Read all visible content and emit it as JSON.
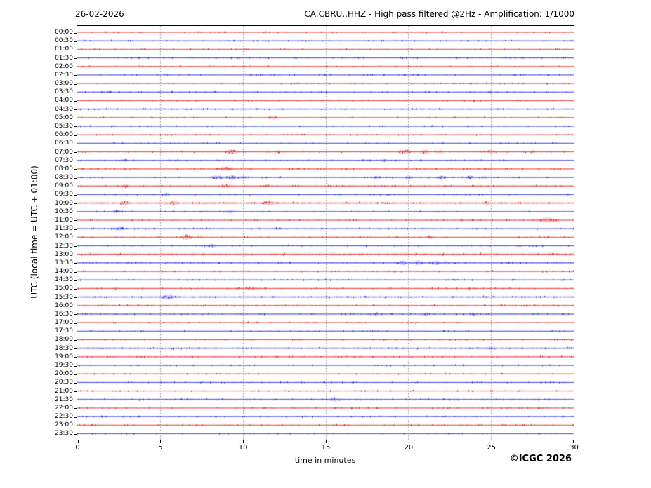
{
  "footer": {
    "copyright": "©ICGC 2026"
  },
  "chart_data": {
    "type": "line",
    "subtype": "helicorder-daily-seismogram",
    "date": "26-02-2026",
    "title": "CA.CBRU..HHZ - High pass filtered @2Hz - Amplification: 1/1000",
    "xlabel": "time in minutes",
    "ylabel": "UTC (local time = UTC + 01:00)",
    "xlim": [
      0,
      30
    ],
    "x_ticks": [
      0,
      5,
      10,
      15,
      20,
      25,
      30
    ],
    "grid": "vertical dashed gray lines every 5 minutes",
    "minutes_per_row": 30,
    "row_color_cycle": [
      "red",
      "blue"
    ],
    "trace_colors": {
      "red": {
        "line": "#ee4545",
        "band": "#f7a6a6",
        "dark": "#cc0808"
      },
      "blue": {
        "line": "#4848ea",
        "band": "#a9a9f6",
        "dark": "#1414c4"
      }
    },
    "frame_color": "#000000",
    "grid_color": "#8a8a8a",
    "rows": [
      {
        "time": "00:00",
        "color": "red",
        "noise_amp": 0.7,
        "events": []
      },
      {
        "time": "00:30",
        "color": "blue",
        "noise_amp": 0.7,
        "events": []
      },
      {
        "time": "01:00",
        "color": "red",
        "noise_amp": 0.7,
        "events": []
      },
      {
        "time": "01:30",
        "color": "blue",
        "noise_amp": 0.9,
        "events": []
      },
      {
        "time": "02:00",
        "color": "red",
        "noise_amp": 0.7,
        "events": []
      },
      {
        "time": "02:30",
        "color": "blue",
        "noise_amp": 0.7,
        "events": []
      },
      {
        "time": "03:00",
        "color": "red",
        "noise_amp": 0.7,
        "events": []
      },
      {
        "time": "03:30",
        "color": "blue",
        "noise_amp": 0.7,
        "events": []
      },
      {
        "time": "04:00",
        "color": "red",
        "noise_amp": 1.0,
        "events": []
      },
      {
        "time": "04:30",
        "color": "blue",
        "noise_amp": 1.0,
        "events": []
      },
      {
        "time": "05:00",
        "color": "red",
        "noise_amp": 0.8,
        "events": [
          [
            11.8,
            0.4,
            1.1
          ]
        ]
      },
      {
        "time": "05:30",
        "color": "blue",
        "noise_amp": 0.7,
        "events": []
      },
      {
        "time": "06:00",
        "color": "red",
        "noise_amp": 0.7,
        "events": []
      },
      {
        "time": "06:30",
        "color": "blue",
        "noise_amp": 0.8,
        "events": []
      },
      {
        "time": "07:00",
        "color": "red",
        "noise_amp": 1.1,
        "events": [
          [
            9.3,
            0.6,
            1.5
          ],
          [
            12.1,
            0.3,
            0.9
          ],
          [
            19.8,
            0.5,
            1.4
          ],
          [
            21.0,
            0.4,
            1.1
          ],
          [
            21.9,
            0.3,
            0.9
          ],
          [
            25.0,
            0.4,
            0.9
          ],
          [
            27.5,
            0.3,
            0.8
          ]
        ]
      },
      {
        "time": "07:30",
        "color": "blue",
        "noise_amp": 0.8,
        "events": [
          [
            2.8,
            0.3,
            0.7
          ],
          [
            18.5,
            0.3,
            0.6
          ]
        ]
      },
      {
        "time": "08:00",
        "color": "red",
        "noise_amp": 0.9,
        "events": [
          [
            9.0,
            0.8,
            1.3
          ],
          [
            10.4,
            0.3,
            0.8
          ]
        ]
      },
      {
        "time": "08:30",
        "color": "blue",
        "noise_amp": 0.9,
        "events": [
          [
            8.4,
            0.5,
            1.3
          ],
          [
            9.3,
            0.6,
            1.5
          ],
          [
            10.0,
            0.3,
            1.0
          ],
          [
            18.1,
            0.3,
            1.1
          ],
          [
            20.0,
            0.3,
            1.2
          ],
          [
            22.0,
            0.4,
            1.1
          ],
          [
            23.7,
            0.3,
            1.0
          ],
          [
            24.6,
            0.3,
            0.8
          ]
        ]
      },
      {
        "time": "09:00",
        "color": "red",
        "noise_amp": 1.0,
        "events": [
          [
            2.9,
            0.4,
            0.8
          ],
          [
            9.0,
            0.5,
            1.1
          ],
          [
            11.5,
            0.3,
            0.8
          ]
        ]
      },
      {
        "time": "09:30",
        "color": "blue",
        "noise_amp": 0.8,
        "events": [
          [
            5.4,
            0.3,
            1.0
          ]
        ]
      },
      {
        "time": "10:00",
        "color": "red",
        "noise_amp": 1.5,
        "events": [
          [
            2.9,
            0.4,
            1.2
          ],
          [
            5.8,
            0.4,
            1.1
          ],
          [
            11.6,
            0.5,
            1.3
          ],
          [
            24.7,
            0.4,
            1.1
          ]
        ]
      },
      {
        "time": "10:30",
        "color": "blue",
        "noise_amp": 0.9,
        "events": [
          [
            2.3,
            0.4,
            0.9
          ],
          [
            9.2,
            0.4,
            0.8
          ]
        ]
      },
      {
        "time": "11:00",
        "color": "red",
        "noise_amp": 0.9,
        "events": [
          [
            28.4,
            0.8,
            1.7
          ]
        ]
      },
      {
        "time": "11:30",
        "color": "blue",
        "noise_amp": 0.9,
        "events": [
          [
            2.5,
            0.5,
            1.1
          ],
          [
            12.1,
            0.3,
            0.7
          ]
        ]
      },
      {
        "time": "12:00",
        "color": "red",
        "noise_amp": 0.9,
        "events": [
          [
            6.6,
            0.5,
            1.7
          ],
          [
            21.3,
            0.4,
            1.1
          ]
        ]
      },
      {
        "time": "12:30",
        "color": "blue",
        "noise_amp": 1.0,
        "events": [
          [
            8.1,
            0.4,
            0.9
          ]
        ]
      },
      {
        "time": "13:00",
        "color": "red",
        "noise_amp": 1.7,
        "events": []
      },
      {
        "time": "13:30",
        "color": "blue",
        "noise_amp": 1.3,
        "events": [
          [
            19.6,
            0.4,
            1.3
          ],
          [
            20.6,
            0.5,
            1.4
          ],
          [
            21.6,
            0.4,
            1.2
          ],
          [
            22.3,
            0.3,
            0.9
          ]
        ]
      },
      {
        "time": "14:00",
        "color": "red",
        "noise_amp": 1.1,
        "events": []
      },
      {
        "time": "14:30",
        "color": "blue",
        "noise_amp": 0.8,
        "events": []
      },
      {
        "time": "15:00",
        "color": "red",
        "noise_amp": 0.9,
        "events": [
          [
            2.3,
            0.3,
            0.7
          ],
          [
            10.5,
            1.0,
            0.6
          ]
        ]
      },
      {
        "time": "15:30",
        "color": "blue",
        "noise_amp": 1.3,
        "events": [
          [
            5.5,
            0.6,
            1.4
          ]
        ]
      },
      {
        "time": "16:00",
        "color": "red",
        "noise_amp": 1.3,
        "events": []
      },
      {
        "time": "16:30",
        "color": "blue",
        "noise_amp": 1.0,
        "events": [
          [
            18.0,
            0.5,
            0.6
          ],
          [
            21.0,
            0.5,
            0.6
          ],
          [
            24.0,
            0.4,
            0.6
          ]
        ]
      },
      {
        "time": "17:00",
        "color": "red",
        "noise_amp": 0.9,
        "events": []
      },
      {
        "time": "17:30",
        "color": "blue",
        "noise_amp": 0.8,
        "events": []
      },
      {
        "time": "18:00",
        "color": "red",
        "noise_amp": 0.8,
        "events": []
      },
      {
        "time": "18:30",
        "color": "blue",
        "noise_amp": 1.4,
        "events": [
          [
            25.0,
            0.4,
            0.6
          ]
        ]
      },
      {
        "time": "19:00",
        "color": "red",
        "noise_amp": 1.0,
        "events": []
      },
      {
        "time": "19:30",
        "color": "blue",
        "noise_amp": 0.8,
        "events": []
      },
      {
        "time": "20:00",
        "color": "red",
        "noise_amp": 0.7,
        "events": []
      },
      {
        "time": "20:30",
        "color": "blue",
        "noise_amp": 0.7,
        "events": []
      },
      {
        "time": "21:00",
        "color": "red",
        "noise_amp": 0.7,
        "events": []
      },
      {
        "time": "21:30",
        "color": "blue",
        "noise_amp": 1.4,
        "events": [
          [
            15.5,
            0.6,
            0.7
          ]
        ]
      },
      {
        "time": "22:00",
        "color": "red",
        "noise_amp": 0.8,
        "events": []
      },
      {
        "time": "22:30",
        "color": "blue",
        "noise_amp": 0.9,
        "events": []
      },
      {
        "time": "23:00",
        "color": "red",
        "noise_amp": 0.7,
        "events": []
      },
      {
        "time": "23:30",
        "color": "blue",
        "noise_amp": 0.7,
        "events": []
      }
    ]
  }
}
